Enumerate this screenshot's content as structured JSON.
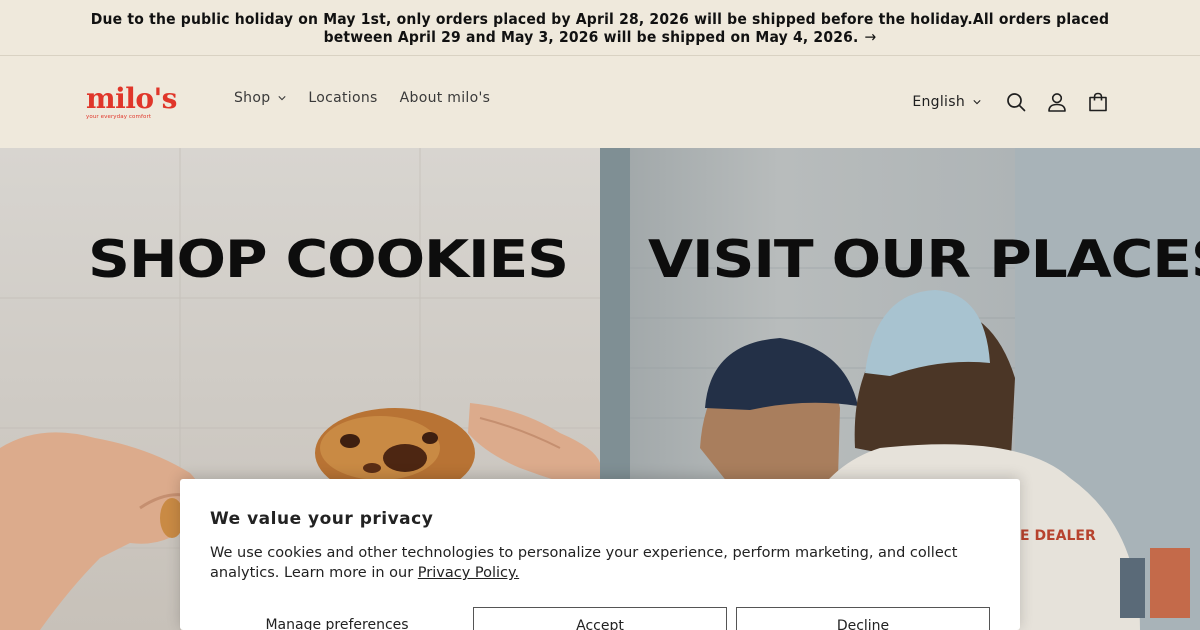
{
  "announcement": {
    "text": "Due to the public holiday on May 1st, only orders placed by April 28, 2026 will be shipped before the holiday.All orders placed between April 29 and May 3, 2026 will be shipped on May 4, 2026.",
    "arrow": "→"
  },
  "header": {
    "logo": {
      "wordmark": "milo's",
      "tagline": "your everyday comfort"
    },
    "nav": [
      {
        "label": "Shop"
      },
      {
        "label": "Locations"
      },
      {
        "label": "About milo's"
      }
    ],
    "language": "English",
    "icons": [
      "search-icon",
      "account-icon",
      "cart-icon"
    ]
  },
  "hero": {
    "left_title": "SHOP COOKIES",
    "right_title": "VISIT OUR PLACES",
    "shirt_text": "E DEALER"
  },
  "cookie_banner": {
    "title": "We value your privacy",
    "body": "We use cookies and other technologies to personalize your experience, perform marketing, and collect analytics. Learn more in our",
    "link": "Privacy Policy.",
    "buttons": {
      "manage": "Manage preferences",
      "accept": "Accept",
      "decline": "Decline"
    }
  },
  "colors": {
    "background": "#efe9dc",
    "brand": "#e0362a",
    "text": "#111111"
  }
}
